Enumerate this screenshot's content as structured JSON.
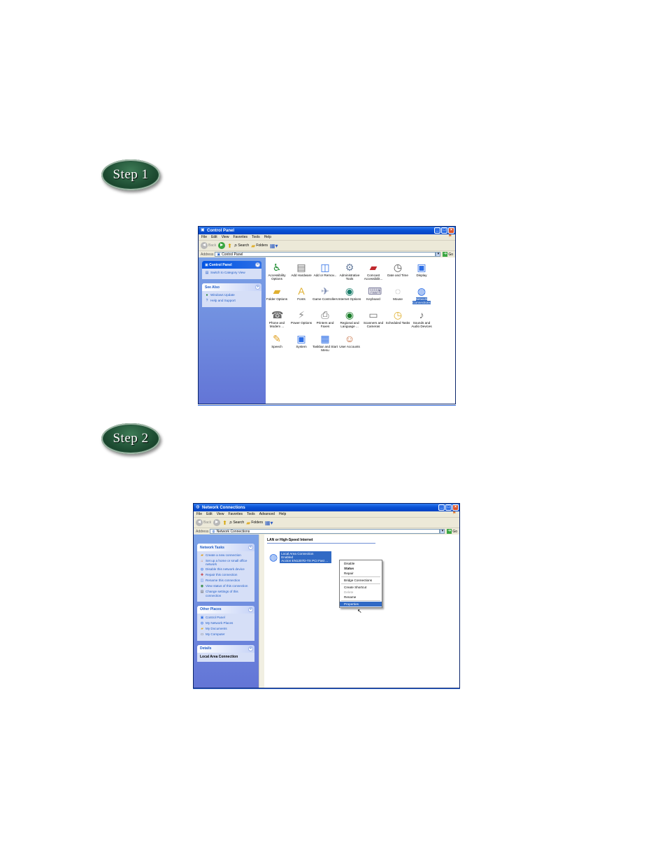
{
  "steps": {
    "step1": "Step 1",
    "step2": "Step 2"
  },
  "control_panel": {
    "title": "Control Panel",
    "menu": [
      "File",
      "Edit",
      "View",
      "Favorites",
      "Tools",
      "Help"
    ],
    "toolbar": {
      "back": "Back",
      "search": "Search",
      "folders": "Folders"
    },
    "address": {
      "label": "Address",
      "value": "Control Panel",
      "go": "Go"
    },
    "sidebar": {
      "panel_title": "Control Panel",
      "switch_link": "Switch to Category View",
      "see_also_title": "See Also",
      "see_also": [
        "Windows Update",
        "Help and Support"
      ]
    },
    "items": [
      {
        "label": "Accessibility Options",
        "icon": "accessibility-icon"
      },
      {
        "label": "Add Hardware",
        "icon": "add-hardware-icon"
      },
      {
        "label": "Add or Remov...",
        "icon": "add-remove-programs-icon"
      },
      {
        "label": "Administrative Tools",
        "icon": "administrative-tools-icon"
      },
      {
        "label": "Comcast Accessibilit...",
        "icon": "comcast-accessibility-icon"
      },
      {
        "label": "Date and Time",
        "icon": "date-time-icon"
      },
      {
        "label": "Display",
        "icon": "display-icon"
      },
      {
        "label": "Folder Options",
        "icon": "folder-options-icon"
      },
      {
        "label": "Fonts",
        "icon": "fonts-icon"
      },
      {
        "label": "Game Controllers",
        "icon": "game-controllers-icon"
      },
      {
        "label": "Internet Options",
        "icon": "internet-options-icon"
      },
      {
        "label": "Keyboard",
        "icon": "keyboard-icon"
      },
      {
        "label": "Mouse",
        "icon": "mouse-icon"
      },
      {
        "label": "Network Connections",
        "icon": "network-connections-icon"
      },
      {
        "label": "Phone and Modem ...",
        "icon": "phone-modem-icon"
      },
      {
        "label": "Power Options",
        "icon": "power-options-icon"
      },
      {
        "label": "Printers and Faxes",
        "icon": "printers-faxes-icon"
      },
      {
        "label": "Regional and Language ...",
        "icon": "regional-language-icon"
      },
      {
        "label": "Scanners and Cameras",
        "icon": "scanners-cameras-icon"
      },
      {
        "label": "Scheduled Tasks",
        "icon": "scheduled-tasks-icon"
      },
      {
        "label": "Sounds and Audio Devices",
        "icon": "sounds-audio-icon"
      },
      {
        "label": "Speech",
        "icon": "speech-icon"
      },
      {
        "label": "System",
        "icon": "system-icon"
      },
      {
        "label": "Taskbar and Start Menu",
        "icon": "taskbar-start-menu-icon"
      },
      {
        "label": "User Accounts",
        "icon": "user-accounts-icon"
      }
    ]
  },
  "network_connections": {
    "title": "Network Connections",
    "menu": [
      "File",
      "Edit",
      "View",
      "Favorites",
      "Tools",
      "Advanced",
      "Help"
    ],
    "toolbar": {
      "back": "Back",
      "search": "Search",
      "folders": "Folders"
    },
    "address": {
      "label": "Address",
      "value": "Network Connections",
      "go": "Go"
    },
    "network_tasks": {
      "title": "Network Tasks",
      "items": [
        "Create a new connection",
        "Set up a home or small office network",
        "Disable this network device",
        "Repair this connection",
        "Rename this connection",
        "View status of this connection",
        "Change settings of this connection"
      ]
    },
    "other_places": {
      "title": "Other Places",
      "items": [
        "Control Panel",
        "My Network Places",
        "My Documents",
        "My Computer"
      ]
    },
    "details": {
      "title": "Details",
      "item": "Local Area Connection"
    },
    "group_header": "LAN or High-Speed Internet",
    "connection": {
      "name": "Local Area Connection",
      "status": "Enabled",
      "adapter": "Accton EN1207D-TX PCI Fast ..."
    },
    "context_menu": {
      "disable": "Disable",
      "status": "Status",
      "repair": "Repair",
      "bridge": "Bridge Connections",
      "shortcut": "Create Shortcut",
      "delete": "Delete",
      "rename": "Rename",
      "properties": "Properties"
    }
  }
}
